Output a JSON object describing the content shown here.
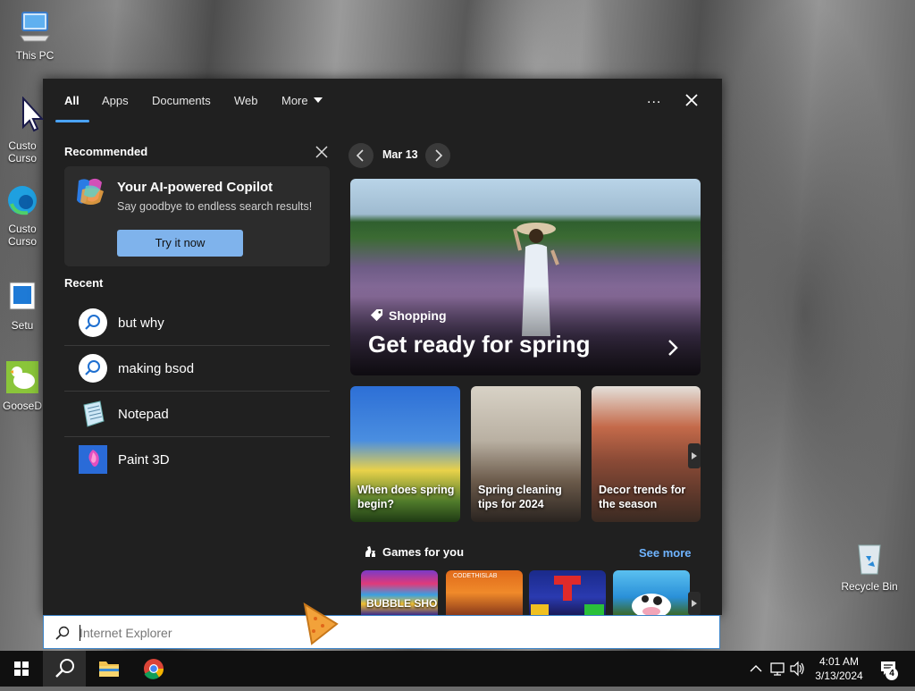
{
  "desktop": {
    "icons": [
      {
        "label": "This PC"
      },
      {
        "label": "Custo Curso"
      },
      {
        "label": "Custo Curso"
      },
      {
        "label": "Setu"
      },
      {
        "label": "GooseD"
      },
      {
        "label": "Recycle Bin"
      }
    ]
  },
  "search_panel": {
    "tabs": [
      {
        "label": "All",
        "active": true
      },
      {
        "label": "Apps"
      },
      {
        "label": "Documents"
      },
      {
        "label": "Web"
      },
      {
        "label": "More"
      }
    ],
    "more_options": "...",
    "recommended": {
      "heading": "Recommended",
      "card": {
        "title": "Your AI-powered Copilot",
        "subtitle": "Say goodbye to endless search results!",
        "button": "Try it now"
      }
    },
    "recent": {
      "heading": "Recent",
      "items": [
        {
          "label": "but why",
          "icon": "search-icon"
        },
        {
          "label": "making bsod",
          "icon": "search-icon"
        },
        {
          "label": "Notepad",
          "icon": "notepad-icon"
        },
        {
          "label": "Paint 3D",
          "icon": "paint3d-icon"
        }
      ]
    },
    "highlights": {
      "date": "Mar 13",
      "hero": {
        "category": "Shopping",
        "headline": "Get ready for spring"
      },
      "cards": [
        {
          "title": "When does spring begin?"
        },
        {
          "title": "Spring cleaning tips for 2024"
        },
        {
          "title": "Decor trends for the season"
        }
      ],
      "games": {
        "heading": "Games for you",
        "see_more": "See more",
        "tiles": [
          {
            "label": "BUBBLE SHOOTER HD"
          },
          {
            "label": "CODETHISLAB"
          },
          {
            "label": ""
          },
          {
            "label": ""
          }
        ]
      }
    }
  },
  "searchbar": {
    "placeholder": "Internet Explorer"
  },
  "taskbar": {
    "time": "4:01 AM",
    "date": "3/13/2024",
    "notifications": "4"
  },
  "colors": {
    "accent": "#4aa3ff",
    "panel_bg": "#202020",
    "card_bg": "#2c2c2c",
    "try_button": "#7fb3ec",
    "link": "#6fb4ff"
  }
}
